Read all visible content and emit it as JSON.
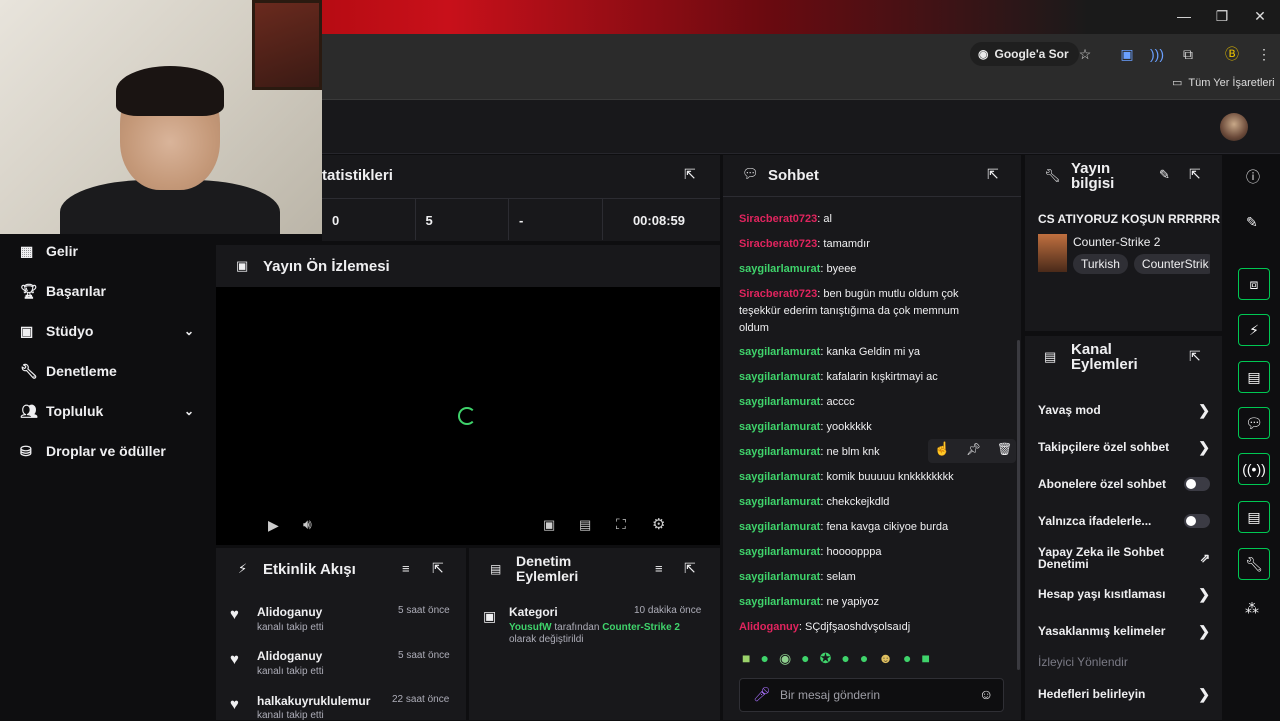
{
  "browser": {
    "ask_google": "Google'a Sor",
    "all_bookmarks": "Tüm Yer İşaretleri"
  },
  "sidebar": {
    "items": [
      {
        "label": "Gelir",
        "icon": "revenue-icon"
      },
      {
        "label": "Başarılar",
        "icon": "trophy-icon"
      },
      {
        "label": "Stüdyo",
        "icon": "studio-icon"
      },
      {
        "label": "Denetleme",
        "icon": "wrench-icon"
      },
      {
        "label": "Topluluk",
        "icon": "community-icon"
      },
      {
        "label": "Droplar ve ödüller",
        "icon": "drops-icon"
      }
    ]
  },
  "stats": {
    "title": "tatistikleri",
    "values": [
      "0",
      "5",
      "-",
      "00:08:59"
    ]
  },
  "preview": {
    "title": "Yayın Ön İzlemesi"
  },
  "activity": {
    "title": "Etkinlik Akışı",
    "items": [
      {
        "user": "Alidoganuy",
        "action": "kanalı takip etti",
        "time": "5 saat önce"
      },
      {
        "user": "Alidoganuy",
        "action": "kanalı takip etti",
        "time": "5 saat önce"
      },
      {
        "user": "halkakuyruklulemur",
        "action": "kanalı takip etti",
        "time": "22 saat önce"
      }
    ]
  },
  "mod_actions": {
    "title": "Denetim Eylemleri",
    "item": {
      "label": "Kategori",
      "time": "10 dakika önce",
      "actor": "YousufW",
      "middle": "tarafından",
      "category": "Counter-Strike 2",
      "suffix": "olarak değiştirildi"
    }
  },
  "chat": {
    "title": "Sohbet",
    "input_placeholder": "Bir mesaj gönderin",
    "messages": [
      {
        "user": "Siracberat0723",
        "color": "#e0245e",
        "text": "al"
      },
      {
        "user": "Siracberat0723",
        "color": "#e0245e",
        "text": "tamamdır"
      },
      {
        "user": "saygilarlamurat",
        "color": "#3fd36b",
        "text": "byeee"
      },
      {
        "user": "Siracberat0723",
        "color": "#e0245e",
        "text": "ben bugün mutlu oldum çok teşekkür ederim tanıştığıma da çok memnum oldum"
      },
      {
        "user": "saygilarlamurat",
        "color": "#3fd36b",
        "text": "kanka Geldin mi ya"
      },
      {
        "user": "saygilarlamurat",
        "color": "#3fd36b",
        "text": "kafalarin kışkirtmayi ac"
      },
      {
        "user": "saygilarlamurat",
        "color": "#3fd36b",
        "text": "acccc"
      },
      {
        "user": "saygilarlamurat",
        "color": "#3fd36b",
        "text": "yookkkkk"
      },
      {
        "user": "saygilarlamurat",
        "color": "#3fd36b",
        "text": "ne blm knk"
      },
      {
        "user": "saygilarlamurat",
        "color": "#3fd36b",
        "text": "komik buuuuu knkkkkkkkk"
      },
      {
        "user": "saygilarlamurat",
        "color": "#3fd36b",
        "text": "chekckejkdld"
      },
      {
        "user": "saygilarlamurat",
        "color": "#3fd36b",
        "text": "fena kavga cikiyoe burda"
      },
      {
        "user": "saygilarlamurat",
        "color": "#3fd36b",
        "text": "hoooopppa"
      },
      {
        "user": "saygilarlamurat",
        "color": "#3fd36b",
        "text": "selam"
      },
      {
        "user": "saygilarlamurat",
        "color": "#3fd36b",
        "text": "ne yapiyoz"
      },
      {
        "user": "Alidoganuy",
        "color": "#e0245e",
        "text": "SÇdjfşaoshdvşolsaıdj"
      }
    ]
  },
  "stream_info": {
    "title": "Yayın bilgisi",
    "stream_title": "CS ATIYORUZ KOŞUN RRRRRR",
    "game": "Counter-Strike 2",
    "tags": [
      "Turkish",
      "CounterStrik"
    ]
  },
  "channel_actions": {
    "title": "Kanal Eylemleri",
    "items": [
      {
        "label": "Yavaş mod",
        "control": "chevron"
      },
      {
        "label": "Takipçilere özel sohbet",
        "control": "chevron"
      },
      {
        "label": "Abonelere özel sohbet",
        "control": "toggle"
      },
      {
        "label": "Yalnızca ifadelerle...",
        "control": "toggle"
      },
      {
        "label": "Yapay Zeka ile Sohbet Denetimi",
        "control": "external"
      },
      {
        "label": "Hesap yaşı kısıtlaması",
        "control": "chevron"
      },
      {
        "label": "Yasaklanmış kelimeler",
        "control": "chevron"
      },
      {
        "label": "İzleyici Yönlendir",
        "control": "none"
      },
      {
        "label": "Hedefleri belirleyin",
        "control": "chevron"
      }
    ]
  },
  "colors": {
    "accent_green": "#00c853",
    "user_red": "#e0245e",
    "user_green": "#3fd36b",
    "panel_bg": "#18181b",
    "page_bg": "#0e0e10"
  }
}
